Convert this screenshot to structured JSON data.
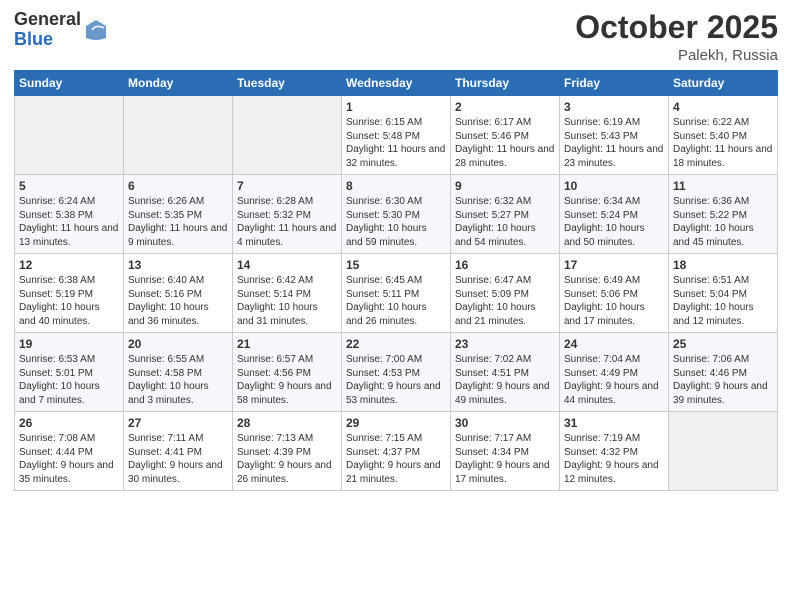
{
  "header": {
    "logo_general": "General",
    "logo_blue": "Blue",
    "month": "October 2025",
    "location": "Palekh, Russia"
  },
  "weekdays": [
    "Sunday",
    "Monday",
    "Tuesday",
    "Wednesday",
    "Thursday",
    "Friday",
    "Saturday"
  ],
  "weeks": [
    [
      {
        "day": "",
        "empty": true
      },
      {
        "day": "",
        "empty": true
      },
      {
        "day": "",
        "empty": true
      },
      {
        "day": "1",
        "sunrise": "Sunrise: 6:15 AM",
        "sunset": "Sunset: 5:48 PM",
        "daylight": "Daylight: 11 hours and 32 minutes."
      },
      {
        "day": "2",
        "sunrise": "Sunrise: 6:17 AM",
        "sunset": "Sunset: 5:46 PM",
        "daylight": "Daylight: 11 hours and 28 minutes."
      },
      {
        "day": "3",
        "sunrise": "Sunrise: 6:19 AM",
        "sunset": "Sunset: 5:43 PM",
        "daylight": "Daylight: 11 hours and 23 minutes."
      },
      {
        "day": "4",
        "sunrise": "Sunrise: 6:22 AM",
        "sunset": "Sunset: 5:40 PM",
        "daylight": "Daylight: 11 hours and 18 minutes."
      }
    ],
    [
      {
        "day": "5",
        "sunrise": "Sunrise: 6:24 AM",
        "sunset": "Sunset: 5:38 PM",
        "daylight": "Daylight: 11 hours and 13 minutes."
      },
      {
        "day": "6",
        "sunrise": "Sunrise: 6:26 AM",
        "sunset": "Sunset: 5:35 PM",
        "daylight": "Daylight: 11 hours and 9 minutes."
      },
      {
        "day": "7",
        "sunrise": "Sunrise: 6:28 AM",
        "sunset": "Sunset: 5:32 PM",
        "daylight": "Daylight: 11 hours and 4 minutes."
      },
      {
        "day": "8",
        "sunrise": "Sunrise: 6:30 AM",
        "sunset": "Sunset: 5:30 PM",
        "daylight": "Daylight: 10 hours and 59 minutes."
      },
      {
        "day": "9",
        "sunrise": "Sunrise: 6:32 AM",
        "sunset": "Sunset: 5:27 PM",
        "daylight": "Daylight: 10 hours and 54 minutes."
      },
      {
        "day": "10",
        "sunrise": "Sunrise: 6:34 AM",
        "sunset": "Sunset: 5:24 PM",
        "daylight": "Daylight: 10 hours and 50 minutes."
      },
      {
        "day": "11",
        "sunrise": "Sunrise: 6:36 AM",
        "sunset": "Sunset: 5:22 PM",
        "daylight": "Daylight: 10 hours and 45 minutes."
      }
    ],
    [
      {
        "day": "12",
        "sunrise": "Sunrise: 6:38 AM",
        "sunset": "Sunset: 5:19 PM",
        "daylight": "Daylight: 10 hours and 40 minutes."
      },
      {
        "day": "13",
        "sunrise": "Sunrise: 6:40 AM",
        "sunset": "Sunset: 5:16 PM",
        "daylight": "Daylight: 10 hours and 36 minutes."
      },
      {
        "day": "14",
        "sunrise": "Sunrise: 6:42 AM",
        "sunset": "Sunset: 5:14 PM",
        "daylight": "Daylight: 10 hours and 31 minutes."
      },
      {
        "day": "15",
        "sunrise": "Sunrise: 6:45 AM",
        "sunset": "Sunset: 5:11 PM",
        "daylight": "Daylight: 10 hours and 26 minutes."
      },
      {
        "day": "16",
        "sunrise": "Sunrise: 6:47 AM",
        "sunset": "Sunset: 5:09 PM",
        "daylight": "Daylight: 10 hours and 21 minutes."
      },
      {
        "day": "17",
        "sunrise": "Sunrise: 6:49 AM",
        "sunset": "Sunset: 5:06 PM",
        "daylight": "Daylight: 10 hours and 17 minutes."
      },
      {
        "day": "18",
        "sunrise": "Sunrise: 6:51 AM",
        "sunset": "Sunset: 5:04 PM",
        "daylight": "Daylight: 10 hours and 12 minutes."
      }
    ],
    [
      {
        "day": "19",
        "sunrise": "Sunrise: 6:53 AM",
        "sunset": "Sunset: 5:01 PM",
        "daylight": "Daylight: 10 hours and 7 minutes."
      },
      {
        "day": "20",
        "sunrise": "Sunrise: 6:55 AM",
        "sunset": "Sunset: 4:58 PM",
        "daylight": "Daylight: 10 hours and 3 minutes."
      },
      {
        "day": "21",
        "sunrise": "Sunrise: 6:57 AM",
        "sunset": "Sunset: 4:56 PM",
        "daylight": "Daylight: 9 hours and 58 minutes."
      },
      {
        "day": "22",
        "sunrise": "Sunrise: 7:00 AM",
        "sunset": "Sunset: 4:53 PM",
        "daylight": "Daylight: 9 hours and 53 minutes."
      },
      {
        "day": "23",
        "sunrise": "Sunrise: 7:02 AM",
        "sunset": "Sunset: 4:51 PM",
        "daylight": "Daylight: 9 hours and 49 minutes."
      },
      {
        "day": "24",
        "sunrise": "Sunrise: 7:04 AM",
        "sunset": "Sunset: 4:49 PM",
        "daylight": "Daylight: 9 hours and 44 minutes."
      },
      {
        "day": "25",
        "sunrise": "Sunrise: 7:06 AM",
        "sunset": "Sunset: 4:46 PM",
        "daylight": "Daylight: 9 hours and 39 minutes."
      }
    ],
    [
      {
        "day": "26",
        "sunrise": "Sunrise: 7:08 AM",
        "sunset": "Sunset: 4:44 PM",
        "daylight": "Daylight: 9 hours and 35 minutes."
      },
      {
        "day": "27",
        "sunrise": "Sunrise: 7:11 AM",
        "sunset": "Sunset: 4:41 PM",
        "daylight": "Daylight: 9 hours and 30 minutes."
      },
      {
        "day": "28",
        "sunrise": "Sunrise: 7:13 AM",
        "sunset": "Sunset: 4:39 PM",
        "daylight": "Daylight: 9 hours and 26 minutes."
      },
      {
        "day": "29",
        "sunrise": "Sunrise: 7:15 AM",
        "sunset": "Sunset: 4:37 PM",
        "daylight": "Daylight: 9 hours and 21 minutes."
      },
      {
        "day": "30",
        "sunrise": "Sunrise: 7:17 AM",
        "sunset": "Sunset: 4:34 PM",
        "daylight": "Daylight: 9 hours and 17 minutes."
      },
      {
        "day": "31",
        "sunrise": "Sunrise: 7:19 AM",
        "sunset": "Sunset: 4:32 PM",
        "daylight": "Daylight: 9 hours and 12 minutes."
      },
      {
        "day": "",
        "empty": true
      }
    ]
  ]
}
